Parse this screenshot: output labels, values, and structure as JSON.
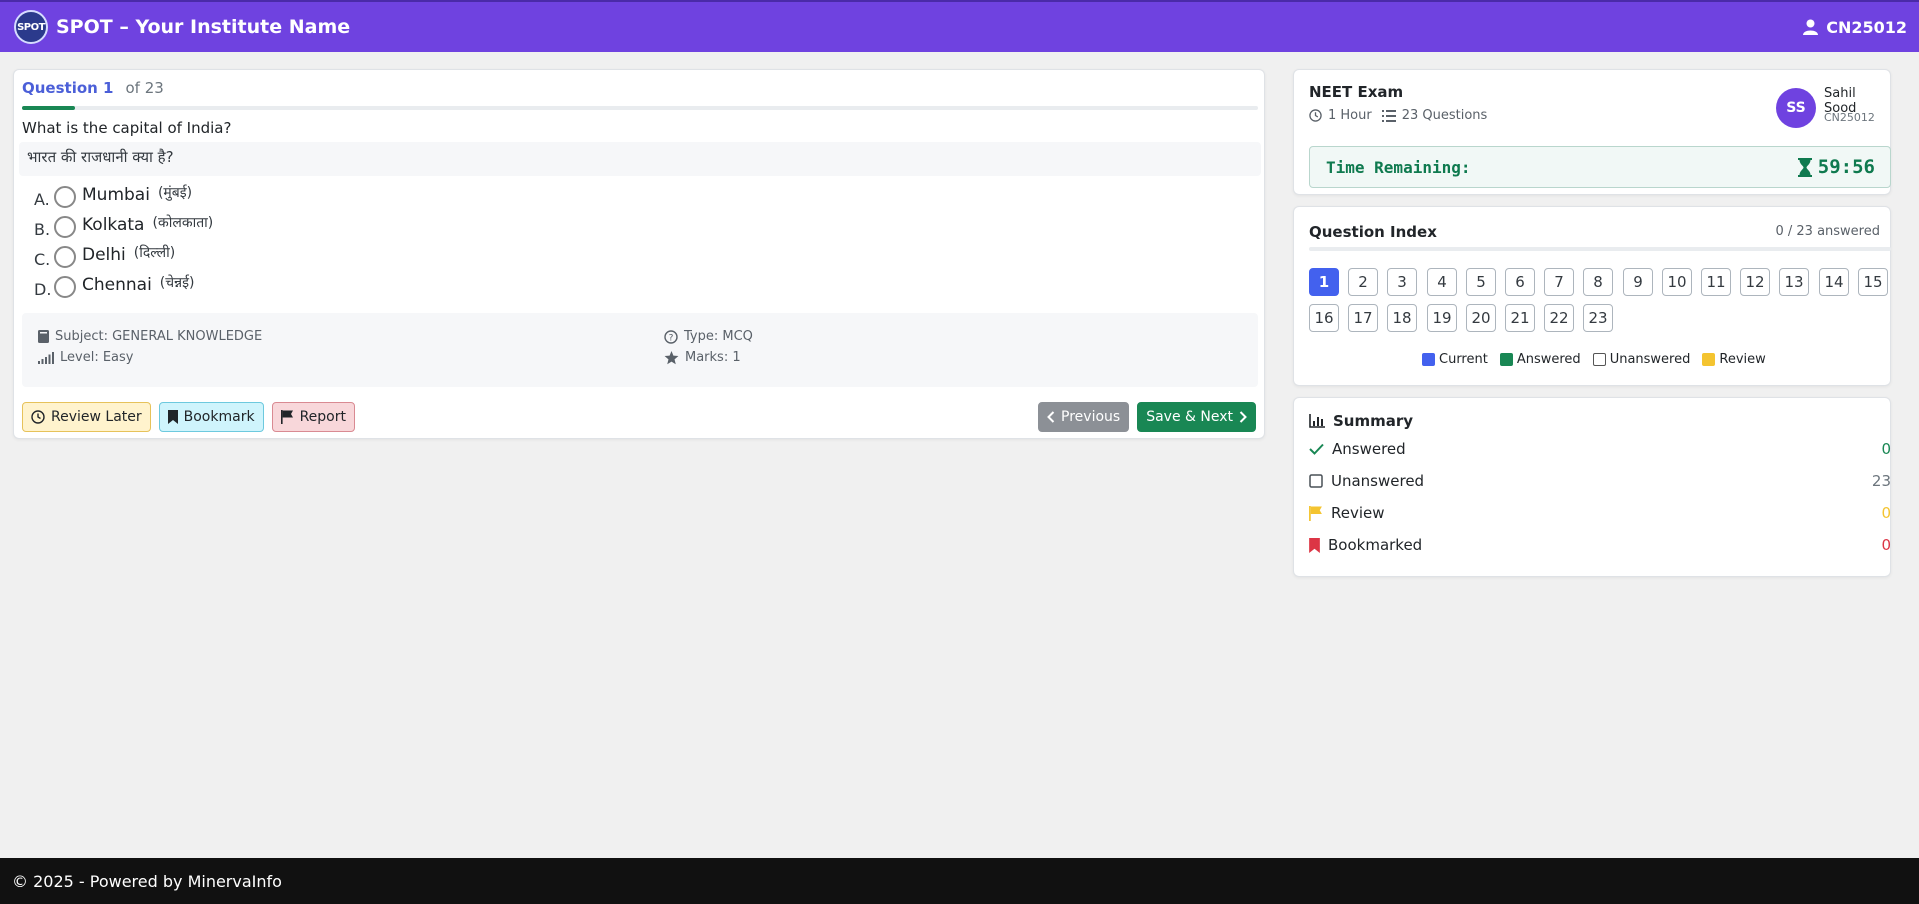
{
  "header": {
    "logo_text": "SPOT",
    "title": "SPOT – Your Institute Name",
    "user_code": "CN25012"
  },
  "question": {
    "label": "Question 1",
    "of_text": "of 23",
    "text_en": "What is the capital of India?",
    "text_hi": "भारत की राजधानी क्या है?",
    "options": [
      {
        "letter": "A.",
        "en": "Mumbai",
        "hi": "(मुंबई)"
      },
      {
        "letter": "B.",
        "en": "Kolkata",
        "hi": "(कोलकाता)"
      },
      {
        "letter": "C.",
        "en": "Delhi",
        "hi": "(दिल्ली)"
      },
      {
        "letter": "D.",
        "en": "Chennai",
        "hi": "(चेन्नई)"
      }
    ],
    "meta": {
      "subject": "Subject: GENERAL KNOWLEDGE",
      "level": "Level: Easy",
      "type": "Type: MCQ",
      "marks": "Marks: 1"
    },
    "actions": {
      "review_later": "Review Later",
      "bookmark": "Bookmark",
      "report": "Report",
      "previous": "Previous",
      "save_next": "Save & Next"
    }
  },
  "exam": {
    "title": "NEET Exam",
    "duration": "1 Hour",
    "questions": "23 Questions",
    "avatar_initials": "SS",
    "user_name": "Sahil Sood",
    "user_id": "CN25012",
    "time_label": "Time Remaining:",
    "time_value": "59:56"
  },
  "index": {
    "title": "Question Index",
    "answered_count": "0 / 23 answered",
    "numbers": [
      "1",
      "2",
      "3",
      "4",
      "5",
      "6",
      "7",
      "8",
      "9",
      "10",
      "11",
      "12",
      "13",
      "14",
      "15",
      "16",
      "17",
      "18",
      "19",
      "20",
      "21",
      "22",
      "23"
    ],
    "legend": {
      "current": "Current",
      "answered": "Answered",
      "unanswered": "Unanswered",
      "review": "Review"
    }
  },
  "summary": {
    "title": "Summary",
    "answered_label": "Answered",
    "answered_value": "0",
    "unanswered_label": "Unanswered",
    "unanswered_value": "23",
    "review_label": "Review",
    "review_value": "0",
    "bookmarked_label": "Bookmarked",
    "bookmarked_value": "0"
  },
  "colors": {
    "brand": "#6f42e0",
    "current": "#4361ee",
    "answered": "#198754",
    "review": "#f4c430",
    "bookmarked": "#dc3545"
  },
  "footer": {
    "text": "© 2025 - Powered by MinervaInfo"
  }
}
